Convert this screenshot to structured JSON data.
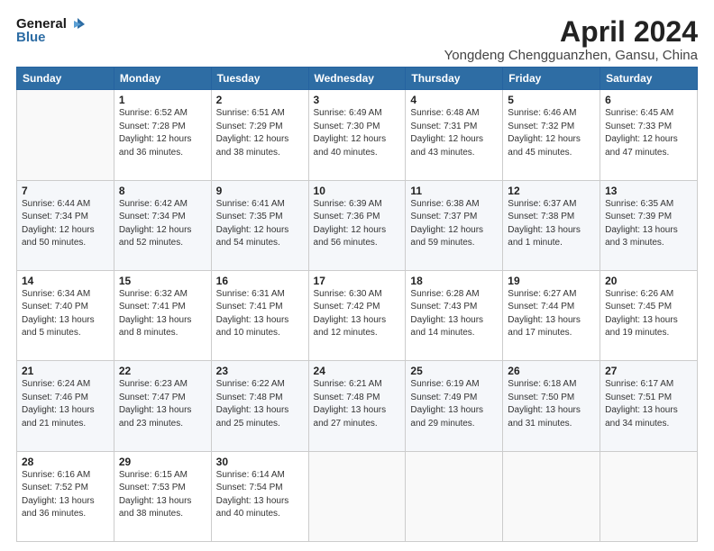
{
  "logo": {
    "line1": "General",
    "line2": "Blue"
  },
  "title": "April 2024",
  "subtitle": "Yongdeng Chengguanzhen, Gansu, China",
  "days_header": [
    "Sunday",
    "Monday",
    "Tuesday",
    "Wednesday",
    "Thursday",
    "Friday",
    "Saturday"
  ],
  "weeks": [
    [
      {
        "day": "",
        "sunrise": "",
        "sunset": "",
        "daylight": ""
      },
      {
        "day": "1",
        "sunrise": "Sunrise: 6:52 AM",
        "sunset": "Sunset: 7:28 PM",
        "daylight": "Daylight: 12 hours and 36 minutes."
      },
      {
        "day": "2",
        "sunrise": "Sunrise: 6:51 AM",
        "sunset": "Sunset: 7:29 PM",
        "daylight": "Daylight: 12 hours and 38 minutes."
      },
      {
        "day": "3",
        "sunrise": "Sunrise: 6:49 AM",
        "sunset": "Sunset: 7:30 PM",
        "daylight": "Daylight: 12 hours and 40 minutes."
      },
      {
        "day": "4",
        "sunrise": "Sunrise: 6:48 AM",
        "sunset": "Sunset: 7:31 PM",
        "daylight": "Daylight: 12 hours and 43 minutes."
      },
      {
        "day": "5",
        "sunrise": "Sunrise: 6:46 AM",
        "sunset": "Sunset: 7:32 PM",
        "daylight": "Daylight: 12 hours and 45 minutes."
      },
      {
        "day": "6",
        "sunrise": "Sunrise: 6:45 AM",
        "sunset": "Sunset: 7:33 PM",
        "daylight": "Daylight: 12 hours and 47 minutes."
      }
    ],
    [
      {
        "day": "7",
        "sunrise": "Sunrise: 6:44 AM",
        "sunset": "Sunset: 7:34 PM",
        "daylight": "Daylight: 12 hours and 50 minutes."
      },
      {
        "day": "8",
        "sunrise": "Sunrise: 6:42 AM",
        "sunset": "Sunset: 7:34 PM",
        "daylight": "Daylight: 12 hours and 52 minutes."
      },
      {
        "day": "9",
        "sunrise": "Sunrise: 6:41 AM",
        "sunset": "Sunset: 7:35 PM",
        "daylight": "Daylight: 12 hours and 54 minutes."
      },
      {
        "day": "10",
        "sunrise": "Sunrise: 6:39 AM",
        "sunset": "Sunset: 7:36 PM",
        "daylight": "Daylight: 12 hours and 56 minutes."
      },
      {
        "day": "11",
        "sunrise": "Sunrise: 6:38 AM",
        "sunset": "Sunset: 7:37 PM",
        "daylight": "Daylight: 12 hours and 59 minutes."
      },
      {
        "day": "12",
        "sunrise": "Sunrise: 6:37 AM",
        "sunset": "Sunset: 7:38 PM",
        "daylight": "Daylight: 13 hours and 1 minute."
      },
      {
        "day": "13",
        "sunrise": "Sunrise: 6:35 AM",
        "sunset": "Sunset: 7:39 PM",
        "daylight": "Daylight: 13 hours and 3 minutes."
      }
    ],
    [
      {
        "day": "14",
        "sunrise": "Sunrise: 6:34 AM",
        "sunset": "Sunset: 7:40 PM",
        "daylight": "Daylight: 13 hours and 5 minutes."
      },
      {
        "day": "15",
        "sunrise": "Sunrise: 6:32 AM",
        "sunset": "Sunset: 7:41 PM",
        "daylight": "Daylight: 13 hours and 8 minutes."
      },
      {
        "day": "16",
        "sunrise": "Sunrise: 6:31 AM",
        "sunset": "Sunset: 7:41 PM",
        "daylight": "Daylight: 13 hours and 10 minutes."
      },
      {
        "day": "17",
        "sunrise": "Sunrise: 6:30 AM",
        "sunset": "Sunset: 7:42 PM",
        "daylight": "Daylight: 13 hours and 12 minutes."
      },
      {
        "day": "18",
        "sunrise": "Sunrise: 6:28 AM",
        "sunset": "Sunset: 7:43 PM",
        "daylight": "Daylight: 13 hours and 14 minutes."
      },
      {
        "day": "19",
        "sunrise": "Sunrise: 6:27 AM",
        "sunset": "Sunset: 7:44 PM",
        "daylight": "Daylight: 13 hours and 17 minutes."
      },
      {
        "day": "20",
        "sunrise": "Sunrise: 6:26 AM",
        "sunset": "Sunset: 7:45 PM",
        "daylight": "Daylight: 13 hours and 19 minutes."
      }
    ],
    [
      {
        "day": "21",
        "sunrise": "Sunrise: 6:24 AM",
        "sunset": "Sunset: 7:46 PM",
        "daylight": "Daylight: 13 hours and 21 minutes."
      },
      {
        "day": "22",
        "sunrise": "Sunrise: 6:23 AM",
        "sunset": "Sunset: 7:47 PM",
        "daylight": "Daylight: 13 hours and 23 minutes."
      },
      {
        "day": "23",
        "sunrise": "Sunrise: 6:22 AM",
        "sunset": "Sunset: 7:48 PM",
        "daylight": "Daylight: 13 hours and 25 minutes."
      },
      {
        "day": "24",
        "sunrise": "Sunrise: 6:21 AM",
        "sunset": "Sunset: 7:48 PM",
        "daylight": "Daylight: 13 hours and 27 minutes."
      },
      {
        "day": "25",
        "sunrise": "Sunrise: 6:19 AM",
        "sunset": "Sunset: 7:49 PM",
        "daylight": "Daylight: 13 hours and 29 minutes."
      },
      {
        "day": "26",
        "sunrise": "Sunrise: 6:18 AM",
        "sunset": "Sunset: 7:50 PM",
        "daylight": "Daylight: 13 hours and 31 minutes."
      },
      {
        "day": "27",
        "sunrise": "Sunrise: 6:17 AM",
        "sunset": "Sunset: 7:51 PM",
        "daylight": "Daylight: 13 hours and 34 minutes."
      }
    ],
    [
      {
        "day": "28",
        "sunrise": "Sunrise: 6:16 AM",
        "sunset": "Sunset: 7:52 PM",
        "daylight": "Daylight: 13 hours and 36 minutes."
      },
      {
        "day": "29",
        "sunrise": "Sunrise: 6:15 AM",
        "sunset": "Sunset: 7:53 PM",
        "daylight": "Daylight: 13 hours and 38 minutes."
      },
      {
        "day": "30",
        "sunrise": "Sunrise: 6:14 AM",
        "sunset": "Sunset: 7:54 PM",
        "daylight": "Daylight: 13 hours and 40 minutes."
      },
      {
        "day": "",
        "sunrise": "",
        "sunset": "",
        "daylight": ""
      },
      {
        "day": "",
        "sunrise": "",
        "sunset": "",
        "daylight": ""
      },
      {
        "day": "",
        "sunrise": "",
        "sunset": "",
        "daylight": ""
      },
      {
        "day": "",
        "sunrise": "",
        "sunset": "",
        "daylight": ""
      }
    ]
  ]
}
